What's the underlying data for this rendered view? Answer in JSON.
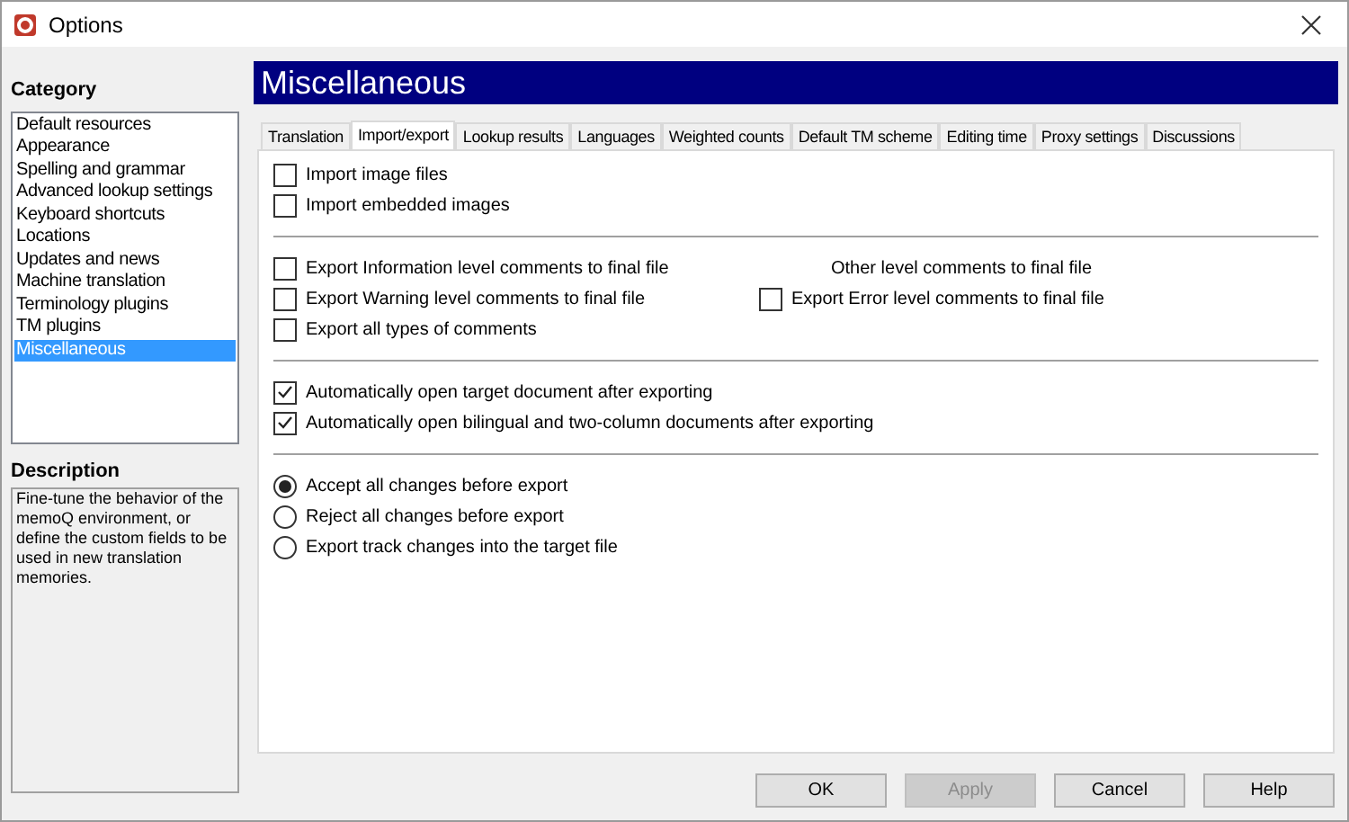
{
  "window": {
    "title": "Options"
  },
  "category": {
    "heading": "Category",
    "items": [
      {
        "label": "Default resources",
        "selected": false
      },
      {
        "label": "Appearance",
        "selected": false
      },
      {
        "label": "Spelling and grammar",
        "selected": false
      },
      {
        "label": "Advanced lookup settings",
        "selected": false
      },
      {
        "label": "Keyboard shortcuts",
        "selected": false
      },
      {
        "label": "Locations",
        "selected": false
      },
      {
        "label": "Updates and news",
        "selected": false
      },
      {
        "label": "Machine translation",
        "selected": false
      },
      {
        "label": "Terminology plugins",
        "selected": false
      },
      {
        "label": "TM plugins",
        "selected": false
      },
      {
        "label": "Miscellaneous",
        "selected": true
      }
    ]
  },
  "description": {
    "heading": "Description",
    "text": "Fine-tune the behavior of the memoQ environment, or define the custom fields to be used in new translation memories."
  },
  "page_title": "Miscellaneous",
  "tabs": [
    {
      "label": "Translation",
      "selected": false
    },
    {
      "label": "Import/export",
      "selected": true
    },
    {
      "label": "Lookup results",
      "selected": false
    },
    {
      "label": "Languages",
      "selected": false
    },
    {
      "label": "Weighted counts",
      "selected": false
    },
    {
      "label": "Default TM scheme",
      "selected": false
    },
    {
      "label": "Editing time",
      "selected": false
    },
    {
      "label": "Proxy settings",
      "selected": false
    },
    {
      "label": "Discussions",
      "selected": false
    }
  ],
  "import_options": [
    {
      "label": "Import image files",
      "checked": false
    },
    {
      "label": "Import embedded images",
      "checked": false
    }
  ],
  "comment_options": [
    {
      "kind": "checkbox",
      "label": "Export Information level comments to final file",
      "checked": false
    },
    {
      "kind": "text",
      "label": "Other level comments to final file"
    },
    {
      "kind": "checkbox",
      "label": "Export Warning level comments to final file",
      "checked": false
    },
    {
      "kind": "checkbox",
      "label": "Export Error level comments to final file",
      "checked": false
    },
    {
      "kind": "checkbox",
      "label": "Export all types of comments",
      "checked": false
    }
  ],
  "open_options": [
    {
      "label": "Automatically open target document after exporting",
      "checked": true
    },
    {
      "label": "Automatically open bilingual and two-column documents after exporting",
      "checked": true
    }
  ],
  "track_changes": [
    {
      "label": "Accept all changes before export",
      "selected": true
    },
    {
      "label": "Reject all changes before export",
      "selected": false
    },
    {
      "label": "Export track changes into the target file",
      "selected": false
    }
  ],
  "buttons": [
    {
      "label": "OK",
      "disabled": false
    },
    {
      "label": "Apply",
      "disabled": true
    },
    {
      "label": "Cancel",
      "disabled": false
    },
    {
      "label": "Help",
      "disabled": false
    }
  ]
}
